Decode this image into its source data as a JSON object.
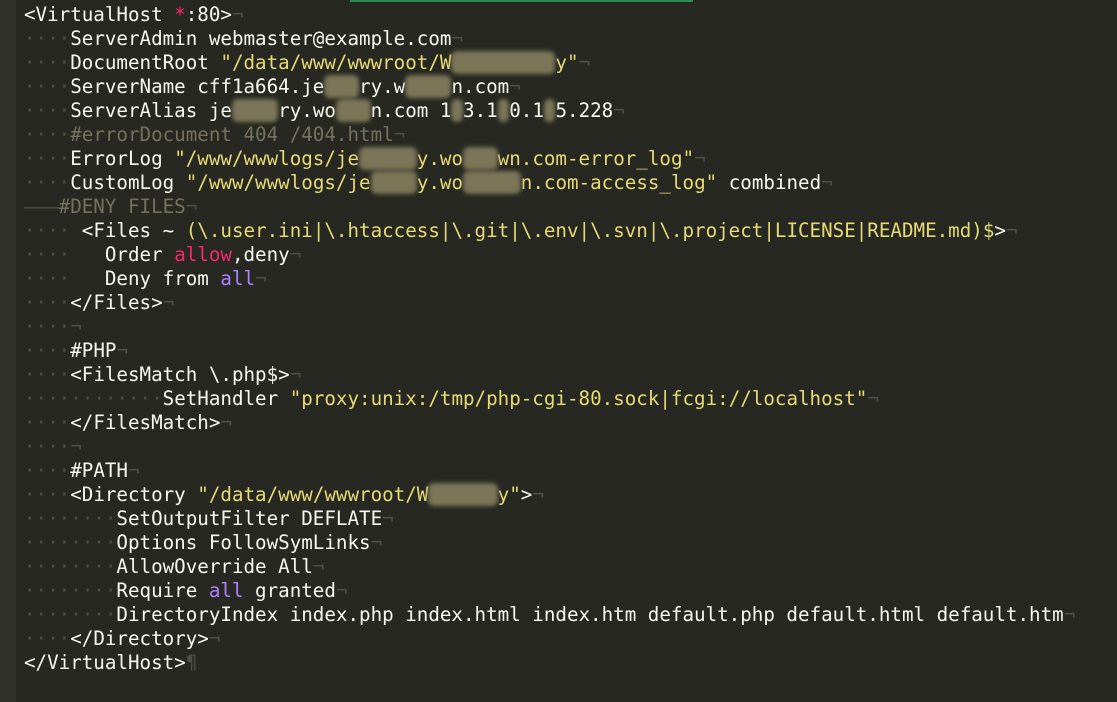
{
  "editor": {
    "lines": [
      [
        [
          "t",
          "<VirtualHost "
        ],
        [
          "kw",
          "*"
        ],
        [
          "t",
          ":80>"
        ],
        [
          "eol",
          "¬"
        ]
      ],
      [
        [
          "ws",
          "····"
        ],
        [
          "t",
          "ServerAdmin webmaster@example.com"
        ],
        [
          "eol",
          "¬"
        ]
      ],
      [
        [
          "ws",
          "····"
        ],
        [
          "t",
          "DocumentRoot "
        ],
        [
          "str",
          "\"/data/www/wwwroot/W"
        ],
        [
          "blur",
          "eb___lory"
        ],
        [
          "str",
          "y\""
        ],
        [
          "eol",
          "¬"
        ]
      ],
      [
        [
          "ws",
          "····"
        ],
        [
          "t",
          "ServerName cff1a664.je"
        ],
        [
          "blur",
          "__e"
        ],
        [
          "t",
          "ry.w"
        ],
        [
          "blur",
          "__ma"
        ],
        [
          "t",
          "n.com"
        ],
        [
          "eol",
          "¬"
        ]
      ],
      [
        [
          "ws",
          "····"
        ],
        [
          "t",
          "ServerAlias je"
        ],
        [
          "blur",
          "____"
        ],
        [
          "t",
          "ry.wo"
        ],
        [
          "blur",
          "___"
        ],
        [
          "t",
          "n.com 1"
        ],
        [
          "blur",
          "_"
        ],
        [
          "t",
          "3.1"
        ],
        [
          "blur",
          "_"
        ],
        [
          "t",
          "0.1"
        ],
        [
          "blur",
          "_"
        ],
        [
          "t",
          "5.228"
        ],
        [
          "eol",
          "¬"
        ]
      ],
      [
        [
          "ws",
          "····"
        ],
        [
          "cmt",
          "#errorDocument 404 /404.html"
        ],
        [
          "eol",
          "¬"
        ]
      ],
      [
        [
          "ws",
          "····"
        ],
        [
          "t",
          "ErrorLog "
        ],
        [
          "str",
          "\"/www/wwwlogs/je"
        ],
        [
          "blur",
          "_____"
        ],
        [
          "str",
          "y.wo"
        ],
        [
          "blur",
          "___"
        ],
        [
          "str",
          "wn.com-error_log\""
        ],
        [
          "eol",
          "¬"
        ]
      ],
      [
        [
          "ws",
          "····"
        ],
        [
          "t",
          "CustomLog "
        ],
        [
          "str",
          "\"/www/wwwlogs/je"
        ],
        [
          "blur",
          "____"
        ],
        [
          "str",
          "y.wo"
        ],
        [
          "blur",
          "_____"
        ],
        [
          "str",
          "n.com-access_log\""
        ],
        [
          "t",
          " combined"
        ],
        [
          "eol",
          "¬"
        ]
      ],
      [
        [
          "ws",
          "———"
        ],
        [
          "cmt",
          "#DENY FILES"
        ],
        [
          "eol",
          "¬"
        ]
      ],
      [
        [
          "ws",
          "····"
        ],
        [
          "t",
          " <Files ~ "
        ],
        [
          "str",
          "(\\.user.ini|\\.htaccess|\\.git|\\.env|\\.svn|\\.project|LICENSE|README.md)$"
        ],
        [
          "t",
          ">"
        ],
        [
          "eol",
          "¬"
        ]
      ],
      [
        [
          "ws",
          "····"
        ],
        [
          "t",
          "   Order "
        ],
        [
          "kw",
          "allow"
        ],
        [
          "t",
          ",deny"
        ],
        [
          "eol",
          "¬"
        ]
      ],
      [
        [
          "ws",
          "····"
        ],
        [
          "t",
          "   Deny from "
        ],
        [
          "lit",
          "all"
        ],
        [
          "eol",
          "¬"
        ]
      ],
      [
        [
          "ws",
          "····"
        ],
        [
          "t",
          "</Files>"
        ],
        [
          "eol",
          "¬"
        ]
      ],
      [
        [
          "ws",
          "····"
        ],
        [
          "eol",
          "¬"
        ]
      ],
      [
        [
          "ws",
          "····"
        ],
        [
          "t",
          "#PHP"
        ],
        [
          "eol",
          "¬"
        ]
      ],
      [
        [
          "ws",
          "····"
        ],
        [
          "t",
          "<FilesMatch \\.php$>"
        ],
        [
          "eol",
          "¬"
        ]
      ],
      [
        [
          "ws",
          "····"
        ],
        [
          "ws",
          "········"
        ],
        [
          "t",
          "SetHandler "
        ],
        [
          "str",
          "\"proxy:unix:/tmp/php-cgi-80.sock|fcgi://localhost\""
        ],
        [
          "eol",
          "¬"
        ]
      ],
      [
        [
          "ws",
          "····"
        ],
        [
          "t",
          "</FilesMatch>"
        ],
        [
          "eol",
          "¬"
        ]
      ],
      [
        [
          "ws",
          "····"
        ],
        [
          "eol",
          "¬"
        ]
      ],
      [
        [
          "ws",
          "····"
        ],
        [
          "t",
          "#PATH"
        ],
        [
          "eol",
          "¬"
        ]
      ],
      [
        [
          "ws",
          "····"
        ],
        [
          "t",
          "<Directory "
        ],
        [
          "str",
          "\"/data/www/wwwroot/W"
        ],
        [
          "blur",
          "e_____"
        ],
        [
          "str",
          "y\""
        ],
        [
          "t",
          ">"
        ],
        [
          "eol",
          "¬"
        ]
      ],
      [
        [
          "ws",
          "········"
        ],
        [
          "t",
          "SetOutputFilter DEFLATE"
        ],
        [
          "eol",
          "¬"
        ]
      ],
      [
        [
          "ws",
          "········"
        ],
        [
          "t",
          "Options FollowSymLinks"
        ],
        [
          "eol",
          "¬"
        ]
      ],
      [
        [
          "ws",
          "········"
        ],
        [
          "t",
          "AllowOverride All"
        ],
        [
          "eol",
          "¬"
        ]
      ],
      [
        [
          "ws",
          "········"
        ],
        [
          "t",
          "Require "
        ],
        [
          "lit",
          "all"
        ],
        [
          "t",
          " granted"
        ],
        [
          "eol",
          "¬"
        ]
      ],
      [
        [
          "ws",
          "········"
        ],
        [
          "t",
          "DirectoryIndex index.php index.html index.htm default.php default.html default.htm"
        ],
        [
          "eol",
          "¬"
        ]
      ],
      [
        [
          "ws",
          "····"
        ],
        [
          "t",
          "</Directory>"
        ],
        [
          "eol",
          "¬"
        ]
      ],
      [
        [
          "t",
          "</VirtualHost>"
        ],
        [
          "eol",
          "¶"
        ]
      ]
    ]
  }
}
